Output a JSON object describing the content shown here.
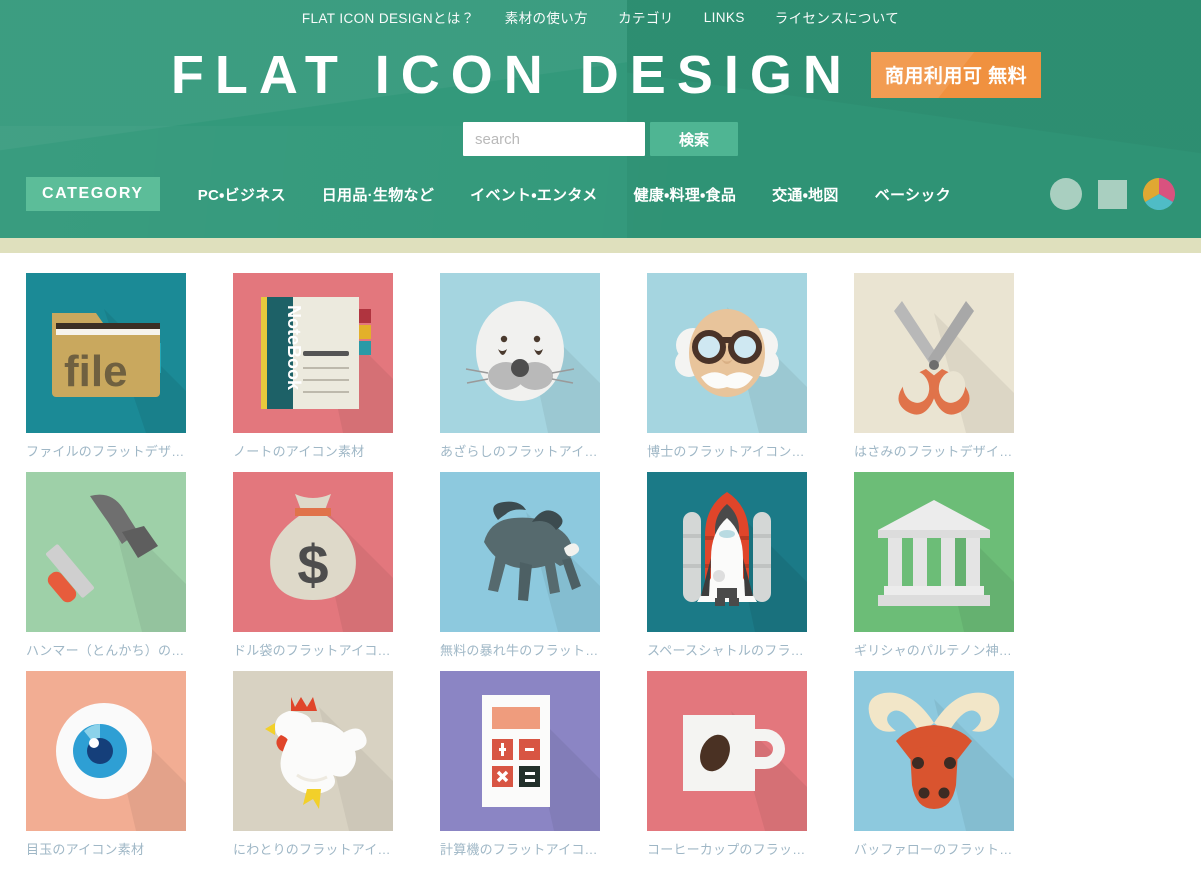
{
  "header": {
    "topnav": [
      {
        "label": "FLAT ICON DESIGNとは？"
      },
      {
        "label": "素材の使い方"
      },
      {
        "label": "カテゴリ"
      },
      {
        "label": "LINKS"
      },
      {
        "label": "ライセンスについて"
      }
    ],
    "brand_title": "FLAT ICON DESIGN",
    "brand_badge": "商用利用可 無料",
    "badge_color": "#f0913f",
    "bg_color": "#2f9375",
    "search": {
      "placeholder": "search",
      "value": "",
      "button_label": "検索"
    },
    "category_badge": "CATEGORY",
    "categories": [
      {
        "label": "PC・ビジネス"
      },
      {
        "label": "日用品·生物など"
      },
      {
        "label": "イベント・エンタメ"
      },
      {
        "label": "健康・料理・食品"
      },
      {
        "label": "交通・地図"
      },
      {
        "label": "ベーシック"
      }
    ],
    "shape_filters": [
      {
        "name": "circle-shape-filter",
        "color": "#a9cfc0"
      },
      {
        "name": "square-shape-filter",
        "color": "#a9cfc0"
      },
      {
        "name": "pie-shape-filter",
        "colors": [
          "#d9527f",
          "#e0a832",
          "#4fbcc6"
        ]
      }
    ]
  },
  "grid": {
    "items": [
      {
        "caption": "ファイルのフラットデザ…",
        "icon": "file-folder-icon",
        "bg": "#1b8a96"
      },
      {
        "caption": "ノートのアイコン素材",
        "icon": "notebook-icon",
        "bg": "#e3777d"
      },
      {
        "caption": "あざらしのフラットアイ…",
        "icon": "seal-icon",
        "bg": "#a5d5e0"
      },
      {
        "caption": "博士のフラットアイコン…",
        "icon": "professor-icon",
        "bg": "#a5d5e0"
      },
      {
        "caption": "はさみのフラットデザイ…",
        "icon": "scissors-icon",
        "bg": "#eae4d2"
      },
      {
        "caption": "ハンマー（とんかち）の…",
        "icon": "hammer-icon",
        "bg": "#9ed0a8"
      },
      {
        "caption": "ドル袋のフラットアイコ…",
        "icon": "money-bag-icon",
        "bg": "#e3777d"
      },
      {
        "caption": "無料の暴れ牛のフラット…",
        "icon": "bull-icon",
        "bg": "#8dc9de"
      },
      {
        "caption": "スペースシャトルのフラ…",
        "icon": "space-shuttle-icon",
        "bg": "#1b7a87"
      },
      {
        "caption": "ギリシャのパルテノン神…",
        "icon": "parthenon-icon",
        "bg": "#6cbd77"
      },
      {
        "caption": "目玉のアイコン素材",
        "icon": "eyeball-icon",
        "bg": "#f2ad93"
      },
      {
        "caption": "にわとりのフラットアイ…",
        "icon": "chicken-icon",
        "bg": "#d8d2c2"
      },
      {
        "caption": "計算機のフラットアイコ…",
        "icon": "calculator-icon",
        "bg": "#8b85c4"
      },
      {
        "caption": "コーヒーカップのフラッ…",
        "icon": "coffee-cup-icon",
        "bg": "#e3777d"
      },
      {
        "caption": "バッファローのフラット…",
        "icon": "buffalo-icon",
        "bg": "#8dc9de"
      }
    ]
  }
}
